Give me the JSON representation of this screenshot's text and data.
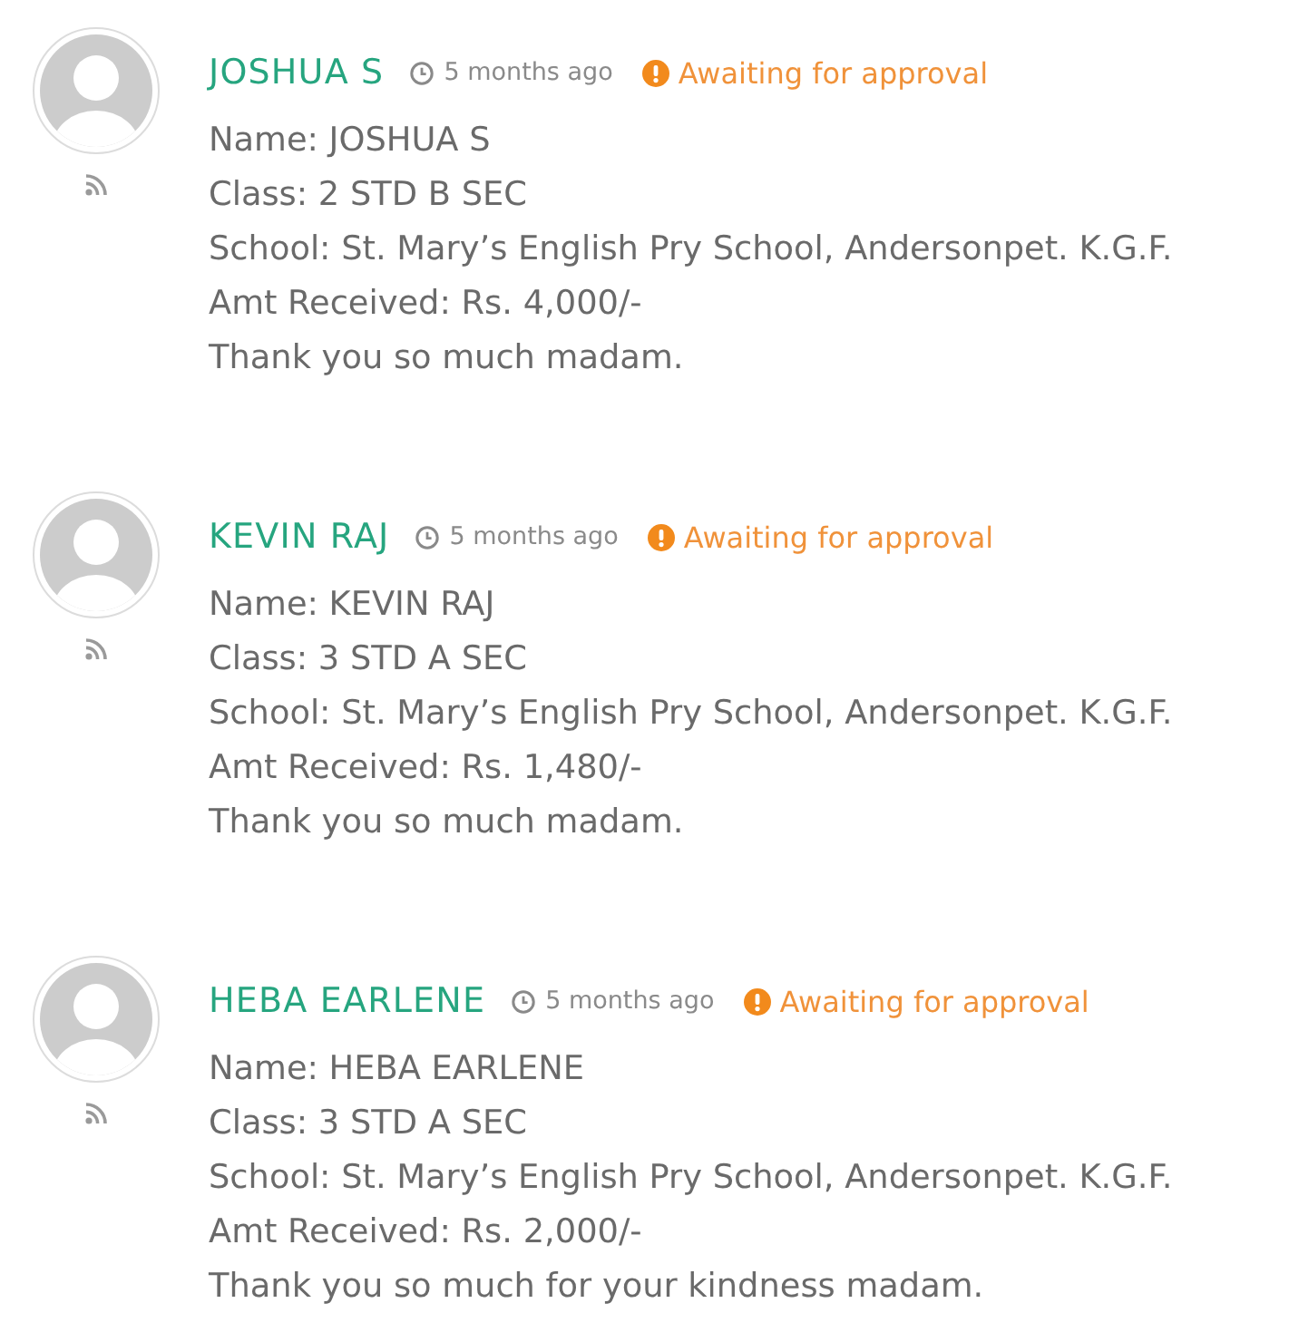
{
  "comments": [
    {
      "author": "JOSHUA S",
      "time": "5 months ago",
      "status": "Awaiting for approval",
      "lines": [
        "Name: JOSHUA S",
        "Class: 2 STD B SEC",
        "School: St. Mary’s English Pry School, Andersonpet. K.G.F.",
        "Amt Received: Rs. 4,000/-",
        "Thank you so much madam."
      ]
    },
    {
      "author": "KEVIN RAJ",
      "time": "5 months ago",
      "status": "Awaiting for approval",
      "lines": [
        "Name: KEVIN RAJ",
        "Class: 3 STD A SEC",
        "School: St. Mary’s English Pry School, Andersonpet. K.G.F.",
        "Amt Received: Rs. 1,480/-",
        "Thank you so much madam."
      ]
    },
    {
      "author": "HEBA EARLENE",
      "time": "5 months ago",
      "status": "Awaiting for approval",
      "lines": [
        "Name: HEBA EARLENE",
        "Class: 3 STD A SEC",
        "School: St. Mary’s English Pry School, Andersonpet. K.G.F.",
        "Amt Received: Rs. 2,000/-",
        "Thank you so much for your kindness madam."
      ]
    }
  ]
}
